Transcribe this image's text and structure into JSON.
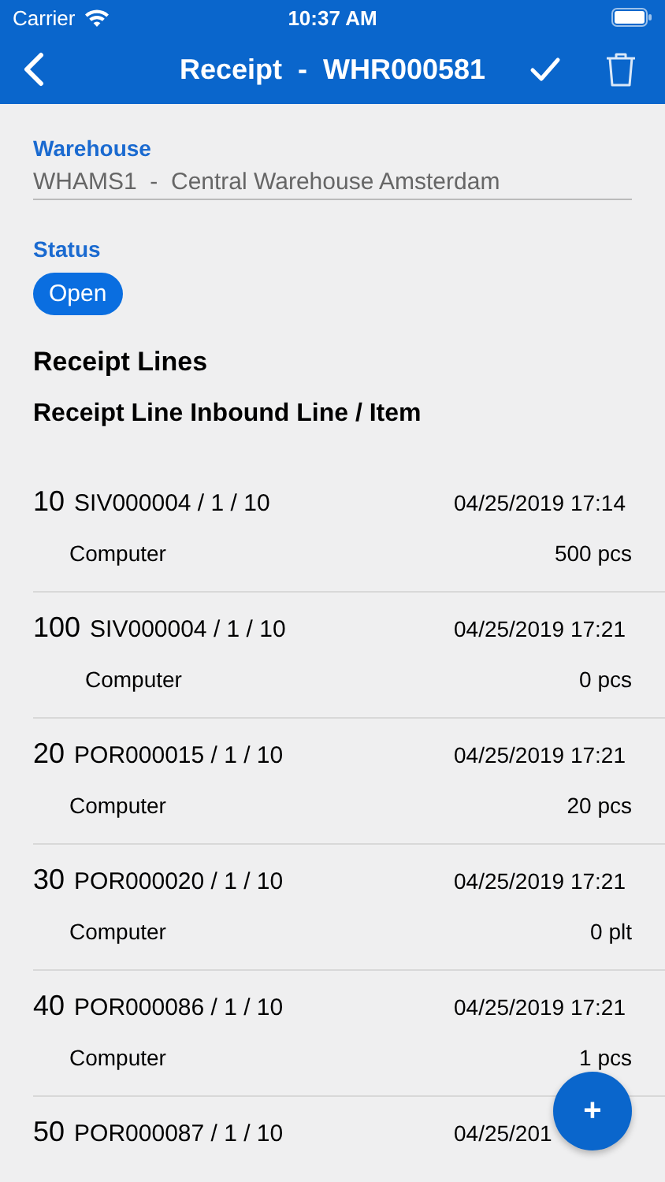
{
  "status_bar": {
    "carrier": "Carrier",
    "time": "10:37 AM"
  },
  "nav_bar": {
    "title": "Receipt  -  WHR000581"
  },
  "warehouse": {
    "label": "Warehouse",
    "value": "WHAMS1  -  Central Warehouse Amsterdam"
  },
  "status": {
    "label": "Status",
    "value": "Open"
  },
  "section_title": "Receipt Lines",
  "list_header": "Receipt Line Inbound Line / Item",
  "lines": [
    {
      "line": "10",
      "order": "SIV000004 / 1 / 10",
      "datetime": "04/25/2019 17:14",
      "item": "Computer",
      "quantity": "500 pcs"
    },
    {
      "line": "100",
      "order": "SIV000004 / 1 / 10",
      "datetime": "04/25/2019 17:21",
      "item": "Computer",
      "quantity": "0 pcs"
    },
    {
      "line": "20",
      "order": "POR000015 / 1 / 10",
      "datetime": "04/25/2019 17:21",
      "item": "Computer",
      "quantity": "20 pcs"
    },
    {
      "line": "30",
      "order": "POR000020 / 1 / 10",
      "datetime": "04/25/2019 17:21",
      "item": "Computer",
      "quantity": "0 plt"
    },
    {
      "line": "40",
      "order": "POR000086 / 1 / 10",
      "datetime": "04/25/2019 17:21",
      "item": "Computer",
      "quantity": "1 pcs"
    },
    {
      "line": "50",
      "order": "POR000087 / 1 / 10",
      "datetime": "04/25/201"
    }
  ],
  "fab": {
    "label": "+"
  }
}
